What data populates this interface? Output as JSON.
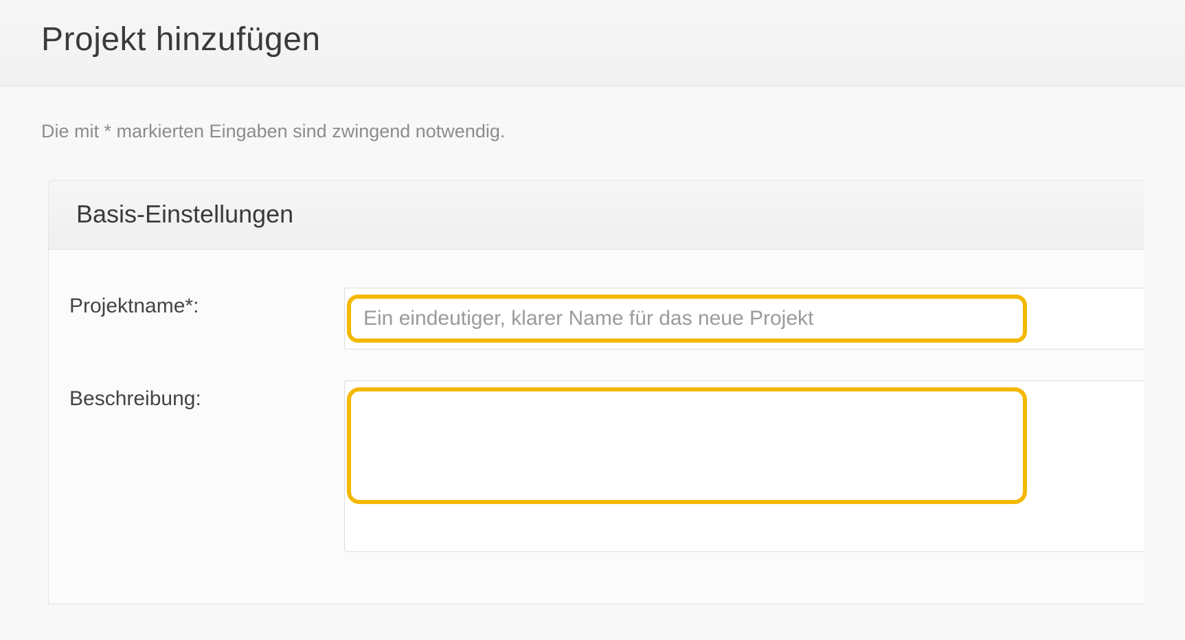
{
  "page": {
    "title": "Projekt hinzufügen",
    "helper_text": "Die mit * markierten Eingaben sind zwingend notwendig."
  },
  "panel": {
    "title": "Basis-Einstellungen"
  },
  "form": {
    "project_name": {
      "label": "Projektname*:",
      "placeholder": "Ein eindeutiger, klarer Name für das neue Projekt",
      "value": ""
    },
    "description": {
      "label": "Beschreibung:",
      "placeholder": "",
      "value": ""
    }
  },
  "highlight_color": "#f4b800"
}
